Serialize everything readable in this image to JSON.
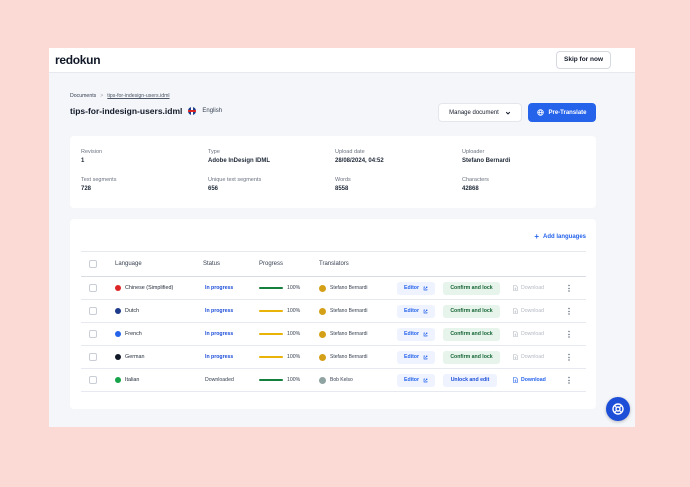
{
  "app": {
    "logo": "redokun",
    "skip_label": "Skip for now"
  },
  "breadcrumb": {
    "root": "Documents",
    "separator": ">",
    "current": "tips-for-indesign-users.idml"
  },
  "document": {
    "title": "tips-for-indesign-users.idml",
    "language": "English"
  },
  "actions": {
    "manage_label": "Manage document",
    "pretranslate_label": "Pre-Translate"
  },
  "info": {
    "revision_label": "Revision",
    "revision": "1",
    "type_label": "Type",
    "type": "Adobe InDesign IDML",
    "upload_date_label": "Upload date",
    "upload_date": "28/08/2024, 04:52",
    "uploader_label": "Uploader",
    "uploader": "Stefano Bernardi",
    "text_segments_label": "Text segments",
    "text_segments": "728",
    "unique_segments_label": "Unique text segments",
    "unique_segments": "656",
    "words_label": "Words",
    "words": "8558",
    "characters_label": "Characters",
    "characters": "42868"
  },
  "table": {
    "add_languages_label": "Add languages",
    "headers": {
      "language": "Language",
      "status": "Status",
      "progress": "Progress",
      "translators": "Translators"
    },
    "rows": [
      {
        "language": "Chinese (Simplified)",
        "flag_color": "#dc2626",
        "status": "In progress",
        "progress": 100,
        "progress_label": "100%",
        "progress_color": "#15803d",
        "translator": "Stefano Bernardi",
        "avatar_color": "#d4a017",
        "editor_label": "Editor",
        "action_label": "Confirm and lock",
        "download_label": "Download",
        "download_enabled": false
      },
      {
        "language": "Dutch",
        "flag_color": "#1e3a8a",
        "status": "In progress",
        "progress": 100,
        "progress_label": "100%",
        "progress_color": "#eab308",
        "translator": "Stefano Bernardi",
        "avatar_color": "#d4a017",
        "editor_label": "Editor",
        "action_label": "Confirm and lock",
        "download_label": "Download",
        "download_enabled": false
      },
      {
        "language": "French",
        "flag_color": "#2563eb",
        "status": "In progress",
        "progress": 100,
        "progress_label": "100%",
        "progress_color": "#eab308",
        "translator": "Stefano Bernardi",
        "avatar_color": "#d4a017",
        "editor_label": "Editor",
        "action_label": "Confirm and lock",
        "download_label": "Download",
        "download_enabled": false
      },
      {
        "language": "German",
        "flag_color": "#111827",
        "status": "In progress",
        "progress": 100,
        "progress_label": "100%",
        "progress_color": "#eab308",
        "translator": "Stefano Bernardi",
        "avatar_color": "#d4a017",
        "editor_label": "Editor",
        "action_label": "Confirm and lock",
        "download_label": "Download",
        "download_enabled": false
      },
      {
        "language": "Italian",
        "flag_color": "#16a34a",
        "status": "Downloaded",
        "progress": 100,
        "progress_label": "100%",
        "progress_color": "#15803d",
        "translator": "Bob Kelso",
        "avatar_color": "#8fa3a0",
        "editor_label": "Editor",
        "action_label": "Unlock and edit",
        "download_label": "Download",
        "download_enabled": true
      }
    ]
  },
  "colors": {
    "accent": "#2563eb",
    "background": "#fbd9d5"
  }
}
